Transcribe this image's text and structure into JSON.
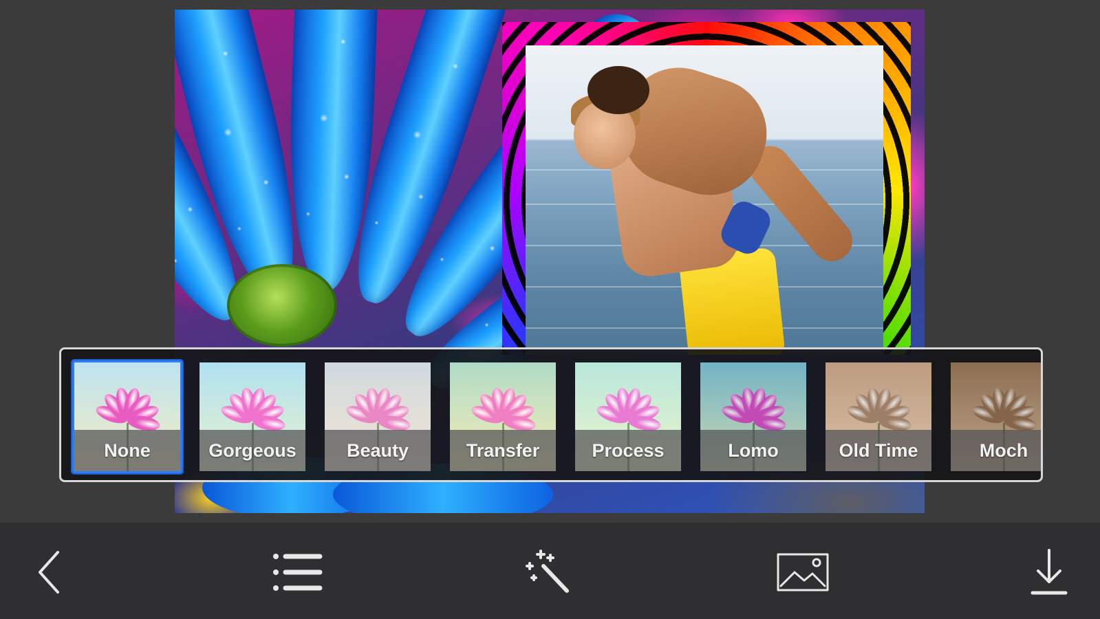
{
  "filters": {
    "selected": "None",
    "items": [
      {
        "label": "None",
        "tint_top": "#bfe3f0",
        "tint_bottom": "#f4ecc0",
        "petal": "#e85bc0",
        "overlay": "rgba(0,0,0,0)"
      },
      {
        "label": "Gorgeous",
        "tint_top": "#a9dff0",
        "tint_bottom": "#e9f1c8",
        "petal": "#ee66c8",
        "overlay": "rgba(255,255,255,0.08)"
      },
      {
        "label": "Beauty",
        "tint_top": "#c9d7de",
        "tint_bottom": "#f3e7cf",
        "petal": "#e67ac0",
        "overlay": "rgba(255,230,230,0.12)"
      },
      {
        "label": "Transfer",
        "tint_top": "#a8d9c9",
        "tint_bottom": "#f6efb8",
        "petal": "#ef73c5",
        "overlay": "rgba(255,240,180,0.10)"
      },
      {
        "label": "Process",
        "tint_top": "#b8e6dc",
        "tint_bottom": "#eef3c6",
        "petal": "#eb6fd0",
        "overlay": "rgba(200,255,230,0.08)"
      },
      {
        "label": "Lomo",
        "tint_top": "#7fc3d6",
        "tint_bottom": "#e4efc0",
        "petal": "#d84fc3",
        "overlay": "rgba(0,40,60,0.10)"
      },
      {
        "label": "Old Time",
        "tint_top": "#caa98f",
        "tint_bottom": "#e9d6c0",
        "petal": "#a48672",
        "overlay": "rgba(120,80,40,0.15)"
      },
      {
        "label": "Moch",
        "tint_top": "#9a7a5f",
        "tint_bottom": "#d8c2a8",
        "petal": "#8f6f55",
        "overlay": "rgba(90,60,30,0.20)"
      }
    ]
  },
  "toolbar": {
    "back_icon": "chevron-left-icon",
    "list_icon": "list-icon",
    "effects_icon": "magic-wand-icon",
    "image_icon": "image-icon",
    "save_icon": "download-icon"
  },
  "colors": {
    "background": "#3b3b3b",
    "toolbar": "#2f2f31",
    "selection": "#2f7df6"
  }
}
